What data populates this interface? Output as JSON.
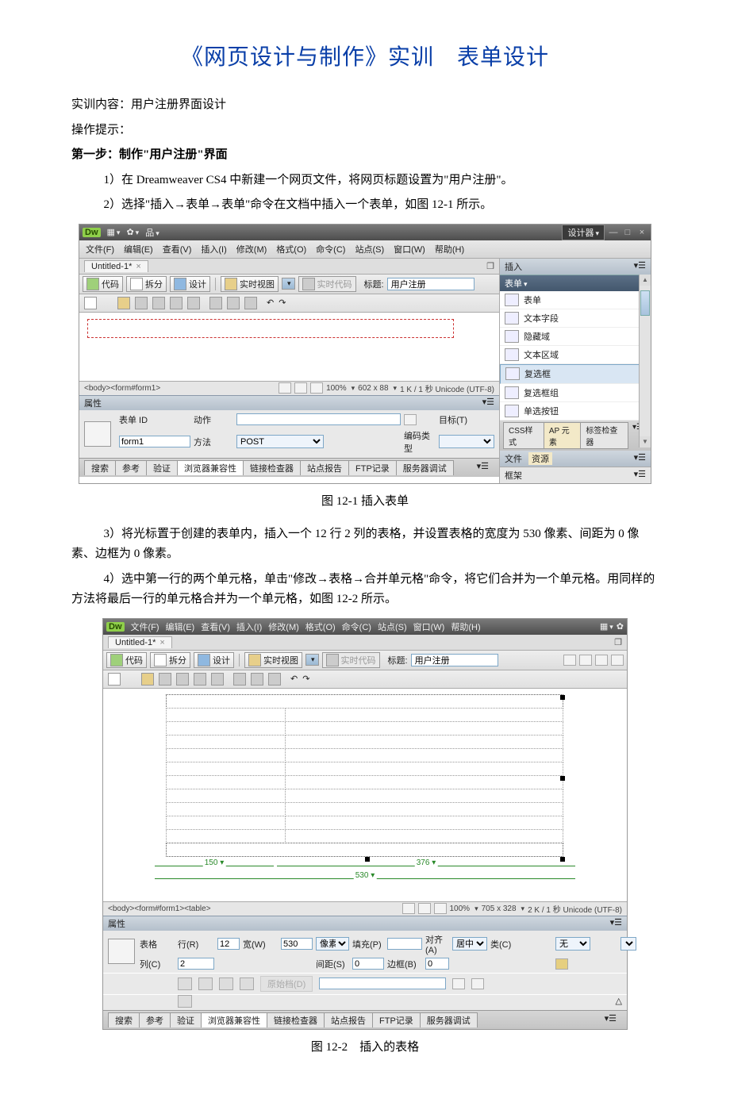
{
  "title": "《网页设计与制作》实训　表单设计",
  "intro": "实训内容：用户注册界面设计",
  "hint_h": "操作提示：",
  "step1_h": "第一步：制作\"用户注册\"界面",
  "step1_1": "1）在 Dreamweaver CS4 中新建一个网页文件，将网页标题设置为\"用户注册\"。",
  "step1_2": "2）选择\"插入→表单→表单\"命令在文档中插入一个表单，如图 12-1 所示。",
  "cap1": "图 12-1  插入表单",
  "step1_3": "3）将光标置于创建的表单内，插入一个 12 行 2 列的表格，并设置表格的宽度为 530 像素、间距为 0 像素、边框为 0 像素。",
  "step1_4": "4）选中第一行的两个单元格，单击\"修改→表格→合并单元格\"命令，将它们合并为一个单元格。用同样的方法将最后一行的单元格合并为一个单元格，如图 12-2 所示。",
  "cap2": "图 12-2　插入的表格",
  "dw": {
    "logo": "Dw",
    "designer": "设计器",
    "menu": [
      "文件(F)",
      "编辑(E)",
      "查看(V)",
      "插入(I)",
      "修改(M)",
      "格式(O)",
      "命令(C)",
      "站点(S)",
      "窗口(W)",
      "帮助(H)"
    ],
    "doc_tab": "Untitled-1*",
    "tb": {
      "code": "代码",
      "split": "拆分",
      "design": "设计",
      "live": "实时视图",
      "livecode": "实时代码",
      "title_lbl": "标题:",
      "title_val": "用户注册"
    },
    "tagsel1": "<body><form#form1>",
    "status1_zoom": "100%",
    "status1_dim": "602 x 88",
    "status1_enc": "1 K / 1 秒 Unicode (UTF-8)",
    "prop_h": "属性",
    "p1": {
      "formid_lbl": "表单 ID",
      "formid_val": "form1",
      "action_lbl": "动作",
      "method_lbl": "方法",
      "method_val": "POST",
      "enctype_lbl": "编码类型",
      "target_lbl": "目标(T)"
    },
    "bottom": [
      "搜索",
      "参考",
      "验证",
      "浏览器兼容性",
      "链接检查器",
      "站点报告",
      "FTP记录",
      "服务器调试"
    ],
    "side": {
      "insert": "插入",
      "cat": "表单",
      "items": [
        "表单",
        "文本字段",
        "隐藏域",
        "文本区域",
        "复选框",
        "复选框组",
        "单选按钮"
      ],
      "csstabs": [
        "CSS样式",
        "AP 元素",
        "标签检查器"
      ],
      "files_tab": "文件",
      "assets_tab": "资源",
      "frame": "框架"
    }
  },
  "dw2": {
    "tagsel": "<body><form#form1><table>",
    "status_zoom": "100%",
    "status_dim": "705 x 328",
    "status_enc": "2 K / 1 秒 Unicode (UTF-8)",
    "dim150": "150",
    "dim376": "376",
    "dim530": "530",
    "p": {
      "table_lbl": "表格",
      "rows_lbl": "行(R)",
      "rows_val": "12",
      "cols_lbl": "列(C)",
      "cols_val": "2",
      "w_lbl": "宽(W)",
      "w_val": "530",
      "w_unit": "像素",
      "pad_lbl": "填充(P)",
      "space_lbl": "间距(S)",
      "space_val": "0",
      "align_lbl": "对齐(A)",
      "align_val": "居中对齐",
      "border_lbl": "边框(B)",
      "border_val": "0",
      "class_lbl": "类(C)",
      "class_val": "无",
      "origbtn": "原始档(D)"
    }
  }
}
